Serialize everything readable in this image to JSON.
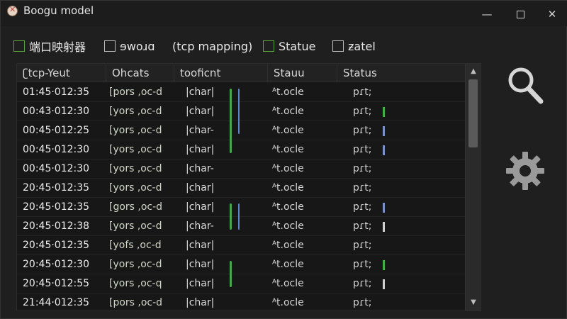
{
  "window": {
    "title": "Boogu model",
    "minimize": "—",
    "close": "✕"
  },
  "filters": [
    {
      "label": "端口映射器",
      "checkbox": "green"
    },
    {
      "label": "ɘwoɹɑ",
      "checkbox": "gray"
    },
    {
      "label": "(tcp mapping)",
      "checkbox": "none"
    },
    {
      "label": "Statue",
      "checkbox": "green"
    },
    {
      "label": "ƶatel",
      "checkbox": "gray"
    }
  ],
  "table": {
    "columns": [
      "ʗtcp-Yeut",
      "Ohcats",
      "tooficnt",
      "Stauu",
      "Status"
    ],
    "rows": [
      {
        "time": "01:45·012:35",
        "ohcats": "[pors ,oc-d",
        "tool": "|char|",
        "stauu": "ᴬt.ocle",
        "status": "pɾt;",
        "bar": "none"
      },
      {
        "time": "00:43·012:30",
        "ohcats": "[yors ,oc-d",
        "tool": "|char|",
        "stauu": "ᴬt.ocle",
        "status": "pɾt;",
        "bar": "green"
      },
      {
        "time": "00:45·012:25",
        "ohcats": "[yors ,oc-d",
        "tool": "|char-",
        "stauu": "ᴬt.ocle",
        "status": "pɾt;",
        "bar": "blue"
      },
      {
        "time": "00:45·012:30",
        "ohcats": "[yors ,oc-d",
        "tool": "|char|",
        "stauu": "ᴬt.ocle",
        "status": "pɾt;",
        "bar": "blue"
      },
      {
        "time": "00:45·012:30",
        "ohcats": "[yors ,oc-d",
        "tool": "|char-",
        "stauu": "ᴬt.ocle",
        "status": "pɾt;",
        "bar": "none"
      },
      {
        "time": "20:45·012:35",
        "ohcats": "[yors ,oc-d",
        "tool": "|char|",
        "stauu": "ᴬt.ocle",
        "status": "pɾt;",
        "bar": "none"
      },
      {
        "time": "20:45·012:35",
        "ohcats": "[gors ,oc-d",
        "tool": "|char|",
        "stauu": "ᴬt.ocle",
        "status": "pɾt;",
        "bar": "blue"
      },
      {
        "time": "20:45·012:38",
        "ohcats": "[yors ,oc-d",
        "tool": "|char-",
        "stauu": "ᴬt.ocle",
        "status": "pɾt;",
        "bar": "white"
      },
      {
        "time": "20:45·012:35",
        "ohcats": "[yofs ,oc-d",
        "tool": "|char|",
        "stauu": "ᴬt.ocle",
        "status": "pɾt;",
        "bar": "none"
      },
      {
        "time": "20:45·012:30",
        "ohcats": "[yors ,oc-d",
        "tool": "|char|",
        "stauu": "ᴬt.ocle",
        "status": "pɾt;",
        "bar": "green"
      },
      {
        "time": "20:45·012:55",
        "ohcats": "[yors ,oc-q",
        "tool": "|char|",
        "stauu": "ᴬt.ocle",
        "status": "pɾt;",
        "bar": "white"
      },
      {
        "time": "21:44·012:35",
        "ohcats": "[pors ,oc-d",
        "tool": "|char|",
        "stauu": "ᴬt.ocle",
        "status": "pɾt;",
        "bar": "none"
      }
    ]
  },
  "colors": {
    "accent_green": "#41b043",
    "accent_blue": "#7a90c8",
    "background": "#1f1f1f"
  },
  "tools": [
    {
      "icon": "search-icon"
    },
    {
      "icon": "gear-icon"
    }
  ]
}
